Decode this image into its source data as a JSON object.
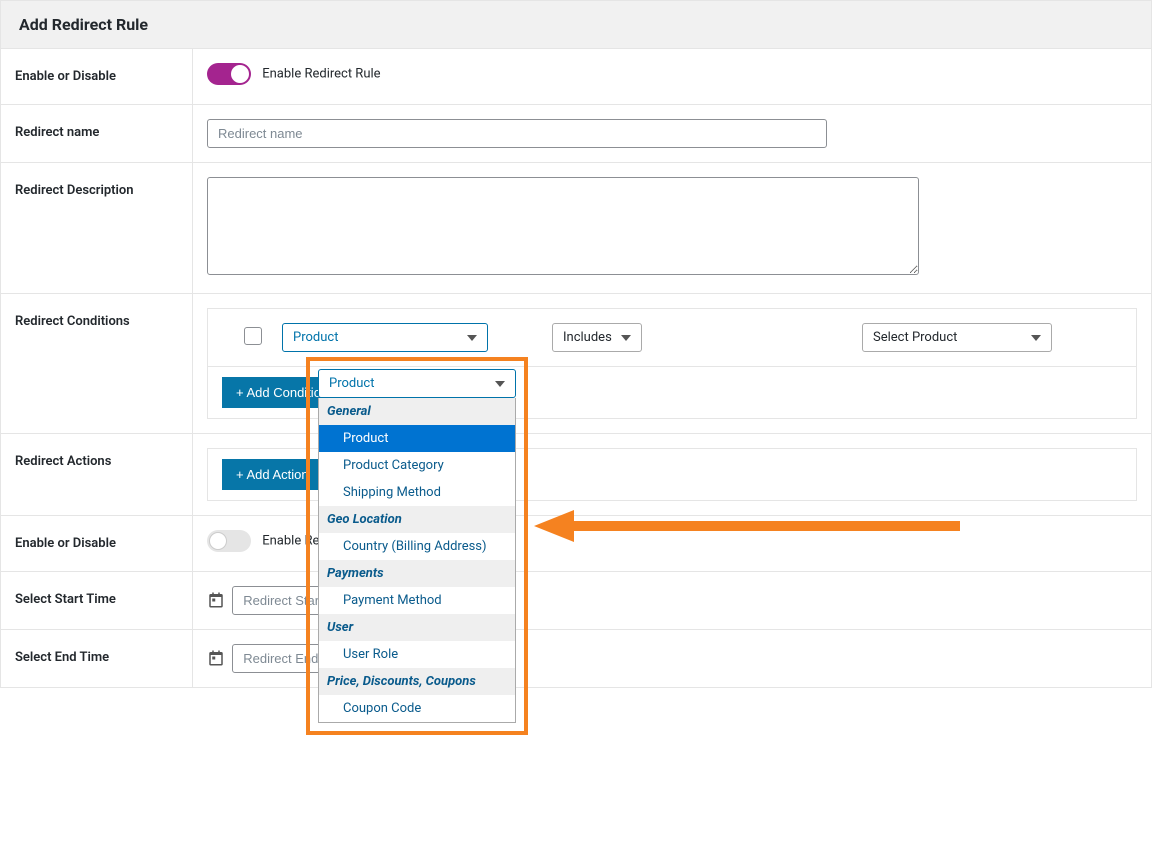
{
  "header": {
    "title": "Add Redirect Rule"
  },
  "rows": {
    "enable1_label": "Enable or Disable",
    "name_label": "Redirect name",
    "desc_label": "Redirect Description",
    "conditions_label": "Redirect Conditions",
    "actions_label": "Redirect Actions",
    "enable2_label": "Enable or Disable",
    "start_label": "Select Start Time",
    "end_label": "Select End Time"
  },
  "toggle1": {
    "text": "Enable Redirect Rule",
    "on": true
  },
  "toggle2": {
    "text": "Enable Redirect Time Range",
    "on": false
  },
  "inputs": {
    "name_placeholder": "Redirect name",
    "start_placeholder": "Redirect Start Date",
    "end_placeholder": "Redirect End Date"
  },
  "conditions": {
    "type_selected": "Product",
    "match_selected": "Includes",
    "value_placeholder": "Select Product",
    "add_btn": "+ Add Condition"
  },
  "actions": {
    "add_btn": "+ Add Action"
  },
  "dropdown": {
    "selected_text": "Product",
    "groups": [
      {
        "label": "General",
        "items": [
          "Product",
          "Product Category",
          "Shipping Method"
        ]
      },
      {
        "label": "Geo Location",
        "items": [
          "Country (Billing Address)"
        ]
      },
      {
        "label": "Payments",
        "items": [
          "Payment Method"
        ]
      },
      {
        "label": "User",
        "items": [
          "User Role"
        ]
      },
      {
        "label": "Price, Discounts, Coupons",
        "items": [
          "Coupon Code"
        ]
      }
    ],
    "selected_item": "Product"
  }
}
